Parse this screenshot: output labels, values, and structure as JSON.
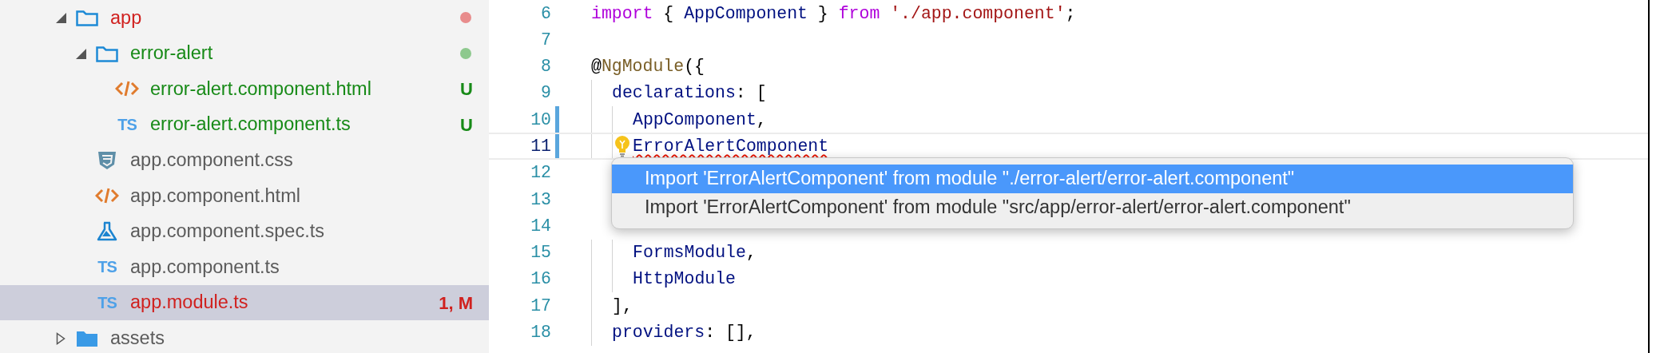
{
  "sidebar": {
    "items": [
      {
        "label": "app",
        "kind": "folder",
        "expanded": true,
        "modified": true,
        "untracked": false,
        "color": "#e88c8c",
        "children": [
          {
            "label": "error-alert",
            "kind": "folder",
            "expanded": true,
            "modified": false,
            "untracked": true,
            "color": "#8ec98e",
            "children": [
              {
                "label": "error-alert.component.html",
                "kind": "html",
                "modified": false,
                "untracked": true,
                "badge": "U"
              },
              {
                "label": "error-alert.component.ts",
                "kind": "ts",
                "icon_label": "TS",
                "modified": false,
                "untracked": true,
                "badge": "U"
              }
            ]
          },
          {
            "label": "app.component.css",
            "kind": "css",
            "modified": false,
            "untracked": false
          },
          {
            "label": "app.component.html",
            "kind": "html",
            "modified": false,
            "untracked": false
          },
          {
            "label": "app.component.spec.ts",
            "kind": "spec",
            "modified": false,
            "untracked": false
          },
          {
            "label": "app.component.ts",
            "kind": "ts",
            "icon_label": "TS",
            "modified": false,
            "untracked": false
          },
          {
            "label": "app.module.ts",
            "kind": "ts",
            "icon_label": "TS",
            "modified": true,
            "untracked": false,
            "badge": "1, M",
            "selected": true
          }
        ]
      },
      {
        "label": "assets",
        "kind": "folder",
        "expanded": false,
        "modified": false,
        "untracked": false
      }
    ]
  },
  "editor": {
    "lines": [
      {
        "number": "6",
        "tokens": [
          {
            "kind": "keyword",
            "text": "import"
          },
          {
            "kind": "punct",
            "text": " { "
          },
          {
            "kind": "ident",
            "text": "AppComponent"
          },
          {
            "kind": "punct",
            "text": " } "
          },
          {
            "kind": "keyword",
            "text": "from"
          },
          {
            "kind": "string",
            "text": " './app.component'"
          },
          {
            "kind": "punct",
            "text": ";"
          }
        ]
      },
      {
        "number": "7"
      },
      {
        "number": "8",
        "tokens": [
          {
            "kind": "punct",
            "text": "@"
          },
          {
            "kind": "function",
            "text": "NgModule"
          },
          {
            "kind": "punct",
            "text": "({"
          }
        ],
        "children": [
          {
            "number": "9",
            "tokens": [
              {
                "kind": "ident",
                "text": "declarations"
              },
              {
                "kind": "punct",
                "text": ": ["
              }
            ],
            "children": [
              {
                "number": "10",
                "changed": true,
                "tokens": [
                  {
                    "kind": "ident",
                    "text": "AppComponent"
                  },
                  {
                    "kind": "punct",
                    "text": ","
                  }
                ]
              },
              {
                "number": "11",
                "changed": true,
                "current": true,
                "lightbulb": true,
                "tokens": [
                  {
                    "kind": "ident",
                    "text": "ErrorAlertComponent",
                    "error": true
                  }
                ]
              },
              {
                "number": "12"
              },
              {
                "number": "13"
              },
              {
                "number": "14"
              },
              {
                "number": "15",
                "tokens": [
                  {
                    "kind": "ident",
                    "text": "FormsModule"
                  },
                  {
                    "kind": "punct",
                    "text": ","
                  }
                ]
              },
              {
                "number": "16",
                "tokens": [
                  {
                    "kind": "ident",
                    "text": "HttpModule"
                  }
                ]
              }
            ]
          },
          {
            "number": "17",
            "tokens": [
              {
                "kind": "punct",
                "text": "],"
              }
            ]
          },
          {
            "number": "18",
            "tokens": [
              {
                "kind": "ident",
                "text": "providers"
              },
              {
                "kind": "punct",
                "text": ": [],"
              }
            ]
          }
        ]
      }
    ]
  },
  "quick_fix_menu": {
    "items": [
      {
        "label": "Import 'ErrorAlertComponent' from module \"./error-alert/error-alert.component\"",
        "selected": true
      },
      {
        "label": "Import 'ErrorAlertComponent' from module \"src/app/error-alert/error-alert.component\"",
        "selected": false
      }
    ]
  }
}
